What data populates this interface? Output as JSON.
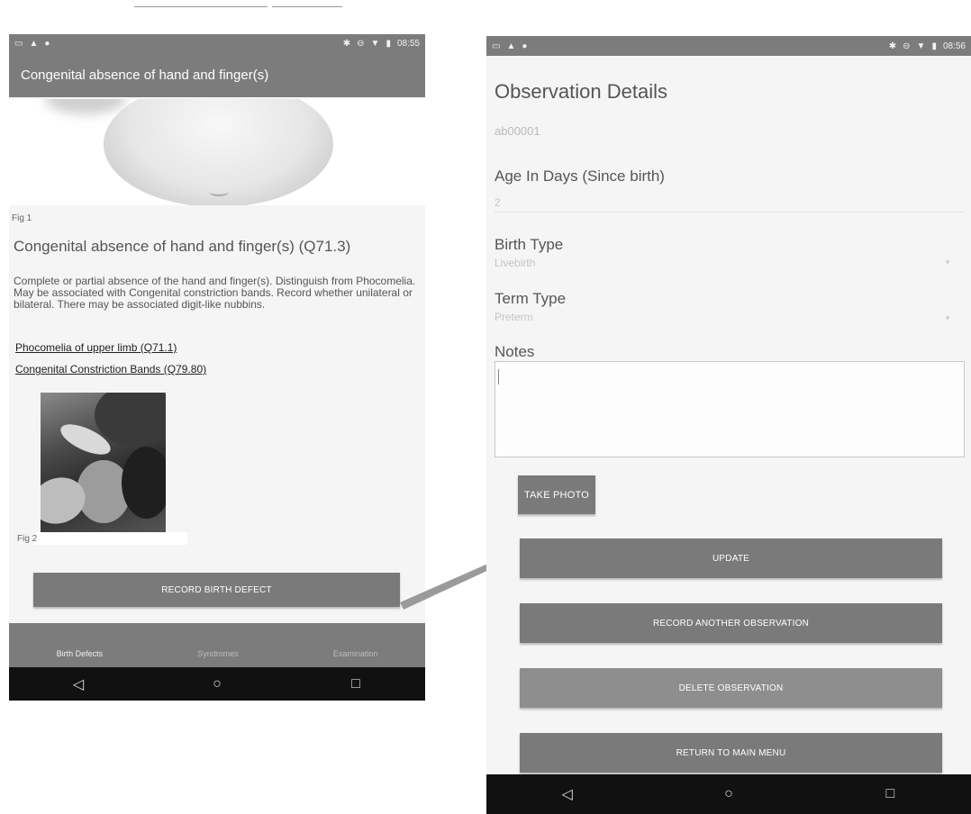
{
  "left_screen": {
    "status_time": "08:55",
    "app_title": "Congenital absence of hand and finger(s)",
    "fig1_caption": "Fig 1",
    "heading": "Congenital absence of hand and finger(s) (Q71.3)",
    "description": "Complete or partial absence of the hand and finger(s). Distinguish from Phocomelia. May be associated with Congenital constriction bands. Record whether unilateral or bilateral. There may be associated digit-like nubbins.",
    "links": [
      "Phocomelia of upper limb (Q71.1)",
      "Congenital Constriction Bands (Q79.80)"
    ],
    "fig2_caption": "Fig 2",
    "record_button": "RECORD BIRTH DEFECT",
    "tabs": [
      {
        "label": "Birth Defects",
        "active": true
      },
      {
        "label": "Syndromes",
        "active": false
      },
      {
        "label": "Examination",
        "active": false
      }
    ]
  },
  "right_screen": {
    "status_time": "08:56",
    "title": "Observation Details",
    "observation_id": "ab00001",
    "age_label": "Age In Days (Since birth)",
    "age_value": "2",
    "birth_type_label": "Birth Type",
    "birth_type_value": "Livebirth",
    "term_type_label": "Term Type",
    "term_type_value": "Preterm",
    "notes_label": "Notes",
    "notes_value": "",
    "take_photo_button": "TAKE PHOTO",
    "update_button": "UPDATE",
    "record_another_button": "RECORD ANOTHER OBSERVATION",
    "delete_button": "DELETE OBSERVATION",
    "return_button": "RETURN TO MAIN MENU"
  },
  "icons": {
    "status_left": [
      "screenshot-icon",
      "warning-icon",
      "android-icon"
    ],
    "status_right": [
      "bluetooth-icon",
      "do-not-disturb-icon",
      "wifi-icon",
      "battery-icon"
    ],
    "nav": [
      "back-icon",
      "home-icon",
      "recents-icon"
    ]
  },
  "colors": {
    "bar_gray": "#7c7c7c",
    "button_gray": "#7a7a7a",
    "nav_black": "#111111",
    "screen_bg": "#f5f5f5"
  }
}
